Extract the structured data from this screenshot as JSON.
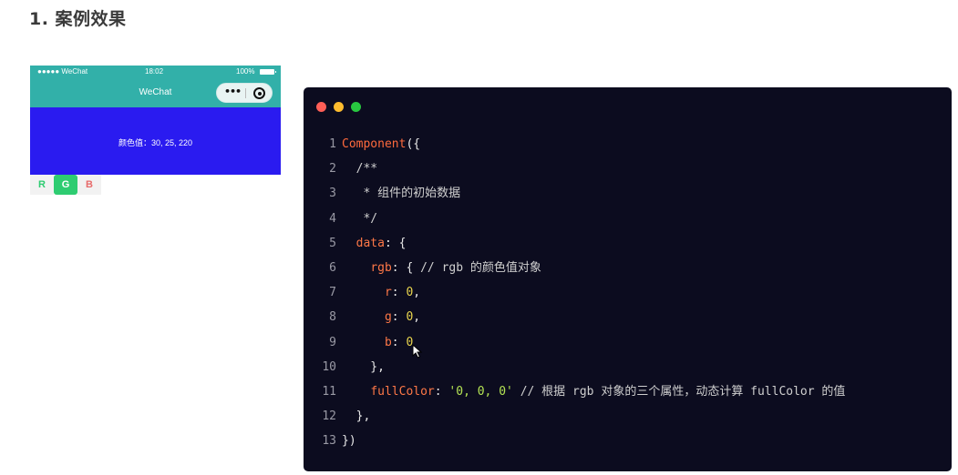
{
  "heading": "1. 案例效果",
  "phone": {
    "status": {
      "carrier": "●●●●● WeChat",
      "time": "18:02",
      "battery": "100%"
    },
    "nav_title": "WeChat",
    "capsule_dots": "•••",
    "color_text": "颜色值：30, 25, 220",
    "background_color": "#2a1bf0",
    "bar_color": "#32b0a9"
  },
  "rgb_buttons": [
    "R",
    "G",
    "B"
  ],
  "code_window": {
    "lines": [
      {
        "n": "1",
        "segs": [
          [
            "kw",
            "Component"
          ],
          [
            "pn",
            "({"
          ]
        ]
      },
      {
        "n": "2",
        "segs": [
          [
            "cm",
            "  /**"
          ]
        ]
      },
      {
        "n": "3",
        "segs": [
          [
            "cm",
            "   * 组件的初始数据"
          ]
        ]
      },
      {
        "n": "4",
        "segs": [
          [
            "cm",
            "   */"
          ]
        ]
      },
      {
        "n": "5",
        "segs": [
          [
            "pn",
            "  "
          ],
          [
            "prop",
            "data"
          ],
          [
            "pn",
            ": {"
          ]
        ]
      },
      {
        "n": "6",
        "segs": [
          [
            "pn",
            "    "
          ],
          [
            "prop",
            "rgb"
          ],
          [
            "pn",
            ": { "
          ],
          [
            "cm",
            "// rgb 的颜色值对象"
          ]
        ]
      },
      {
        "n": "7",
        "segs": [
          [
            "pn",
            "      "
          ],
          [
            "prop",
            "r"
          ],
          [
            "pn",
            ": "
          ],
          [
            "num",
            "0"
          ],
          [
            "pn",
            ","
          ]
        ]
      },
      {
        "n": "8",
        "segs": [
          [
            "pn",
            "      "
          ],
          [
            "prop",
            "g"
          ],
          [
            "pn",
            ": "
          ],
          [
            "num",
            "0"
          ],
          [
            "pn",
            ","
          ]
        ]
      },
      {
        "n": "9",
        "segs": [
          [
            "pn",
            "      "
          ],
          [
            "prop",
            "b"
          ],
          [
            "pn",
            ": "
          ],
          [
            "num",
            "0"
          ]
        ]
      },
      {
        "n": "10",
        "segs": [
          [
            "pn",
            "    },"
          ]
        ]
      },
      {
        "n": "11",
        "segs": [
          [
            "pn",
            "    "
          ],
          [
            "prop",
            "fullColor"
          ],
          [
            "pn",
            ": "
          ],
          [
            "str",
            "'0, 0, 0'"
          ],
          [
            "pn",
            " "
          ],
          [
            "cm",
            "// 根据 rgb 对象的三个属性，动态计算 fullColor 的值"
          ]
        ]
      },
      {
        "n": "12",
        "segs": [
          [
            "pn",
            "  },"
          ]
        ]
      },
      {
        "n": "13",
        "segs": [
          [
            "pn",
            "})"
          ]
        ]
      }
    ]
  }
}
